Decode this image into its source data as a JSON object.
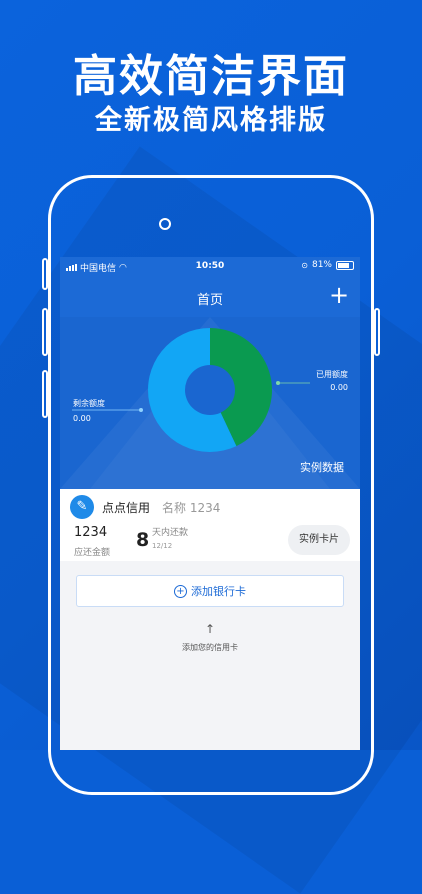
{
  "promo": {
    "headline": "高效简洁界面",
    "subline": "全新极简风格排版"
  },
  "status_bar": {
    "carrier": "中国电信",
    "time": "10:50",
    "battery": "81%"
  },
  "nav": {
    "title": "首页",
    "add_icon": "plus-icon"
  },
  "chart_data": {
    "type": "pie",
    "variant": "donut",
    "slices": [
      {
        "label": "已用额度",
        "value_text": "0.00",
        "color": "#0a9a50"
      },
      {
        "label": "剩余额度",
        "value_text": "0.00",
        "color": "#12a6f5"
      }
    ]
  },
  "sample_data_label": "实例数据",
  "card": {
    "bank_name": "点点信用",
    "alias": "名称 1234",
    "amount": "1234",
    "amount_label": "应还金额",
    "days": "8",
    "days_label": "天内还款",
    "due_date": "12/12",
    "button": "实例卡片"
  },
  "add_card_button": "添加银行卡",
  "empty_hint": {
    "arrow": "↑",
    "text": "添加您的信用卡"
  },
  "colors": {
    "background": "#0a5fd6",
    "nav": "#1c6ad6",
    "used": "#0a9a50",
    "remaining": "#12a6f5"
  }
}
